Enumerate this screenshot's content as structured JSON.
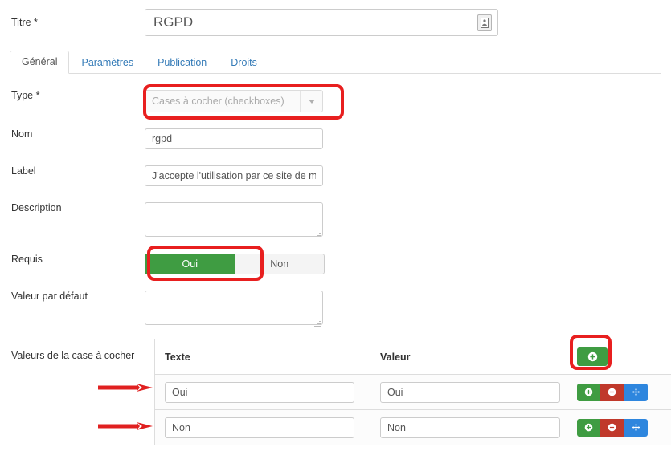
{
  "form": {
    "title_label": "Titre",
    "required_mark": "*",
    "title_value": "RGPD",
    "title_icon": "article-document-icon"
  },
  "tabs": [
    {
      "label": "Général",
      "active": true
    },
    {
      "label": "Paramètres",
      "active": false
    },
    {
      "label": "Publication",
      "active": false
    },
    {
      "label": "Droits",
      "active": false
    }
  ],
  "fields": {
    "type": {
      "label": "Type",
      "required_mark": "*",
      "selected": "Cases à cocher (checkboxes)",
      "disabled": true,
      "caret_icon": "chevron-down-icon"
    },
    "nom": {
      "label": "Nom",
      "value": "rgpd"
    },
    "label": {
      "label": "Label",
      "value": "J'accepte l'utilisation par ce site de mes données"
    },
    "description": {
      "label": "Description",
      "value": ""
    },
    "requis": {
      "label": "Requis",
      "yes_label": "Oui",
      "no_label": "Non",
      "selected": "Oui"
    },
    "valeur_defaut": {
      "label": "Valeur par défaut",
      "value": ""
    }
  },
  "values_section": {
    "label": "Valeurs de la case à cocher",
    "columns": [
      "Texte",
      "Valeur"
    ],
    "add_button_icon": "plus-circle-icon",
    "rows": [
      {
        "texte": "Oui",
        "valeur": "Oui",
        "actions": [
          "plus-circle-icon",
          "minus-circle-icon",
          "move-arrows-icon"
        ]
      },
      {
        "texte": "Non",
        "valeur": "Non",
        "actions": [
          "plus-circle-icon",
          "minus-circle-icon",
          "move-arrows-icon"
        ]
      }
    ]
  },
  "annotations": {
    "highlight_color": "#e81f1f",
    "arrow_color": "#e02020",
    "boxes": [
      "type-select-highlight",
      "requis-oui-highlight",
      "add-row-button-highlight"
    ],
    "arrows": [
      "arrow-to-row-1",
      "arrow-to-row-2"
    ]
  },
  "colors": {
    "green": "#3f9c42",
    "red": "#c0392b",
    "blue": "#2e86de",
    "link": "#337ab7",
    "text": "#333333"
  }
}
